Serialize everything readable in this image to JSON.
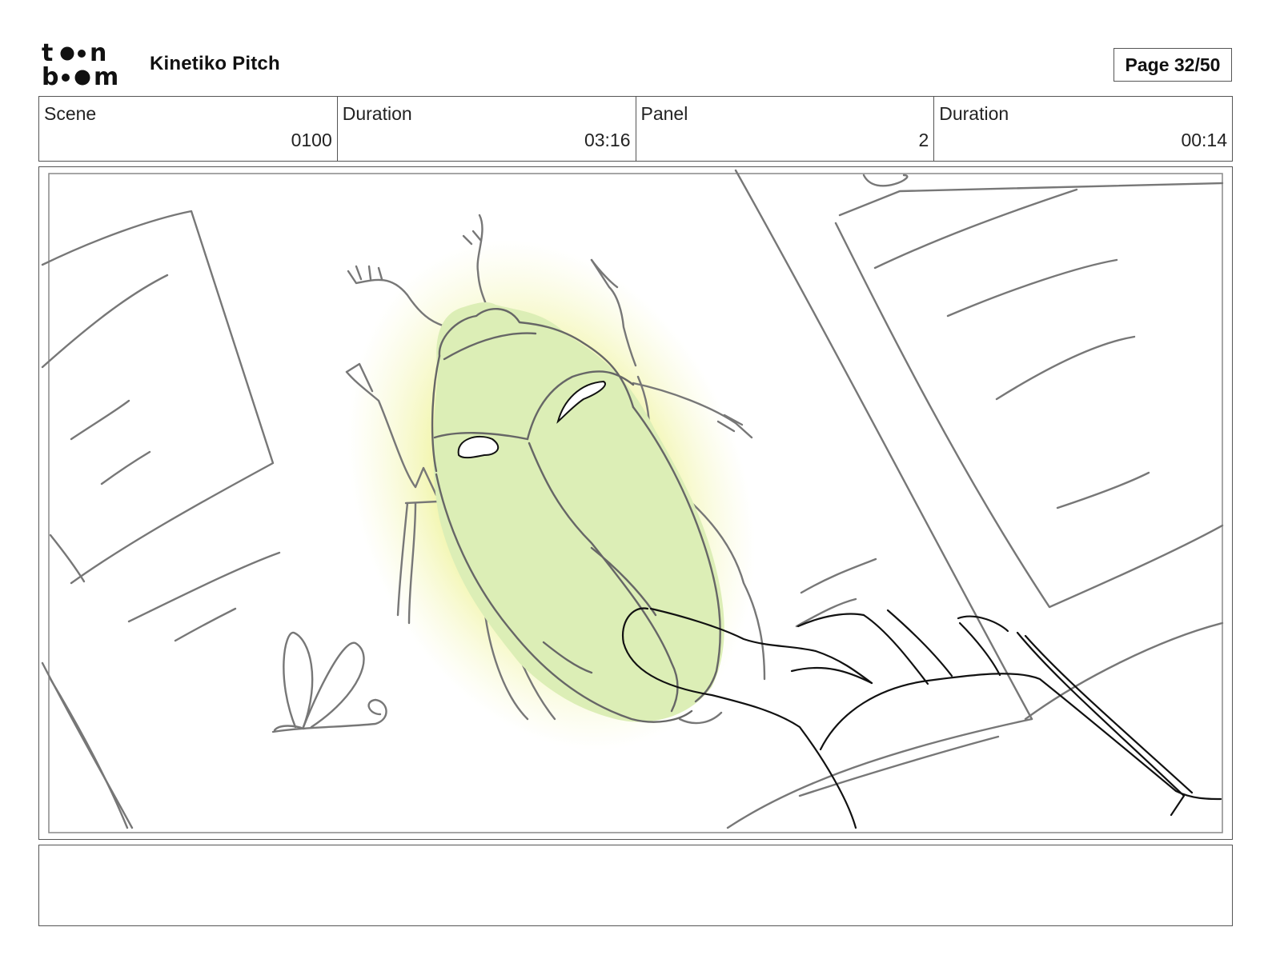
{
  "header": {
    "logo": {
      "name": "toon-boom-logo",
      "line1": "toon",
      "line2": "boom"
    },
    "project_title": "Kinetiko Pitch",
    "page_label": "Page 32/50"
  },
  "info": [
    {
      "label": "Scene",
      "value": "0100"
    },
    {
      "label": "Duration",
      "value": "03:16"
    },
    {
      "label": "Panel",
      "value": "2"
    },
    {
      "label": "Duration",
      "value": "00:14"
    }
  ],
  "panel": {
    "description": "",
    "colors": {
      "sketch": "#777777",
      "ink": "#111111",
      "beetle_fill": "#dfedbb",
      "glow": "#f3f5b0"
    }
  },
  "notes": {
    "text": ""
  }
}
